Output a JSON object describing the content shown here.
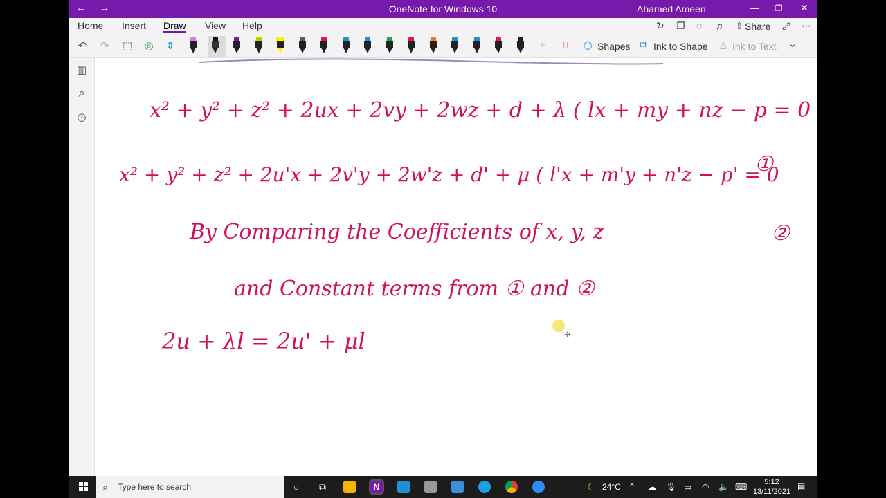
{
  "window": {
    "title": "OneNote for Windows 10",
    "user": "Ahamed Ameen",
    "back_glyph": "←",
    "forward_glyph": "→",
    "minimize_glyph": "—",
    "restore_glyph": "❐",
    "close_glyph": "✕"
  },
  "ribbon": {
    "tabs": [
      "Home",
      "Insert",
      "Draw",
      "View",
      "Help"
    ],
    "active_tab": "Draw",
    "share_label": "Share",
    "sync_icon": "↻",
    "page_icon": "❐",
    "bulb_icon": "◌",
    "bell_icon": "♫",
    "share_icon": "⇪",
    "expand_icon": "⤢",
    "more_icon": "⋯"
  },
  "toolbar": {
    "undo": "↶",
    "redo": "↷",
    "lasso": "⬚",
    "eraser": "◎",
    "add_space": "⇕",
    "add_pen": "+",
    "ruler": "⎍",
    "shapes_label": "Shapes",
    "shapes_icon": "⬡",
    "ink_to_shape_label": "Ink to Shape",
    "ink_to_shape_icon": "⧉",
    "ink_to_text_label": "Ink to Text",
    "ink_to_text_icon": "♙",
    "chevron": "⌄",
    "pen_colors": [
      "#e86fe6",
      "#111111",
      "#7719aa",
      "#a5d900",
      "#fff200",
      "#5a5a5a",
      "#e0115f",
      "#1e90d6",
      "#1e90d6",
      "#12a750",
      "#e0115f",
      "#f07a1b",
      "#1e90d6",
      "#1e90d6",
      "#e0115f",
      "#222222"
    ]
  },
  "sidebar": {
    "notebooks_icon": "▥",
    "search_icon": "⌕",
    "recent_icon": "◷"
  },
  "canvas": {
    "ink_color": "#d0105a",
    "lines": [
      "x² + y² + z² + 2ux + 2vy + 2wz + d + λ ( lx + my + nz − p = 0",
      "①",
      "x² + y² + z² + 2u'x + 2v'y + 2w'z + d' + μ ( l'x + m'y + n'z − p' = 0",
      "②",
      "By Comparing the Coefficients of x, y, z",
      "and Constant terms from ① and ②",
      "2u + λl = 2u' + μl"
    ]
  },
  "taskbar": {
    "search_placeholder": "Type here to search",
    "search_glyph": "⌕",
    "cortana_glyph": "○",
    "taskview_glyph": "⧉",
    "onenote_letter": "N",
    "weather_glyph": "☾",
    "temperature": "24°C",
    "tray_glyphs": [
      "⌃",
      "☁",
      "🎙",
      "▭",
      "◠",
      "🔈",
      "⌨"
    ],
    "time": "5:12",
    "date": "13/11/2021",
    "notification_glyph": "▤"
  }
}
